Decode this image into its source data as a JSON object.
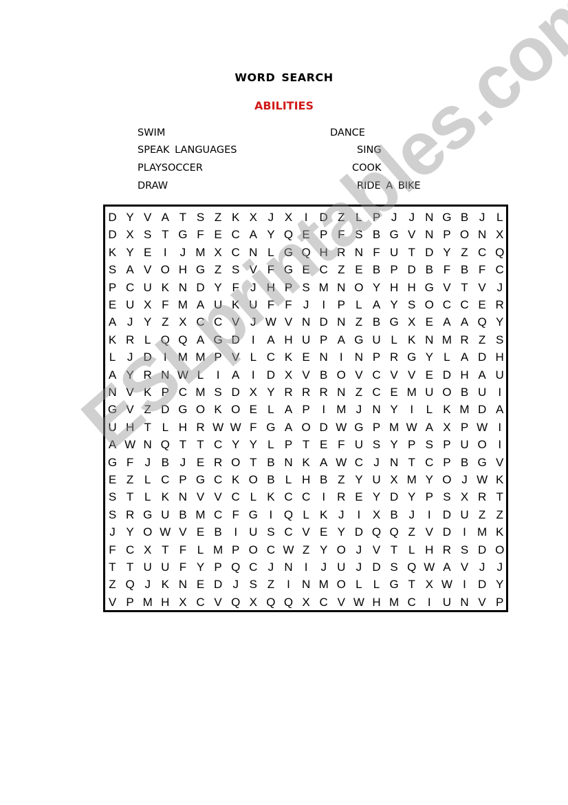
{
  "header": {
    "title": "WORD  SEARCH",
    "subtitle": "ABILITIES",
    "subtitle_color": "#d01a1a"
  },
  "word_list": {
    "left": [
      "SWIM",
      "SPEAK  LANGUAGES",
      "PLAYSOCCER",
      "DRAW"
    ],
    "right": [
      "DANCE",
      "SING",
      "COOK",
      "RIDE  A  BIKE"
    ]
  },
  "grid": [
    "DYVATSZKXJXIDZLPJJNGBJL",
    "DXSTGFECAYQEPFSBGVNPONX",
    "KYEIJMXCNLGQHRNFUTDYZCQ",
    "SAVOHGZSVFGECZEBPDBFBFC",
    "PCUKNDYFJHPSMNOYHHGVTVJ",
    "EUXFMAUKUFFJIPLAYSOCCER",
    "AJYZXCCVJWVNDNZBGXEAAQY",
    "KRLQQAGDIAHUPAGULKNMRZS",
    "LJDIMMPVLCKENINPRGYLADH",
    "AYRNWLIAIDXVBOVCVVEDHAU",
    "NVKPCMSDXYRRRNZCEMUOBUI",
    "GVZDGOKOELAPIMJNYILKMDA",
    "UHTLHRWWFGAODWGPMWAXPWI",
    "AWNQTTCYYLPTEFUSYPSPUOI",
    "GFJBJEROTBNKAWCJNTCPBGV",
    "EZLCPGCKOBLHBZYUXMYOJWK",
    "STLKNVVCLKCCIREYDYPSXRT",
    "SRGUBMCFGIQLKJIXBJIDUZZ",
    "JYOWVEBIUSCVEYDQQZVDIMK",
    "FCXTFLMPOCWZYOJVTLHRSDO",
    "TTUUFYPQCJNIJUJDSQWAVJJ",
    "ZQJKNEDJSZINMOLLGTXWIDY",
    "VPMHXCVQXQQXCVWHMCIUNVP"
  ],
  "watermark": "ESLprintables.com"
}
